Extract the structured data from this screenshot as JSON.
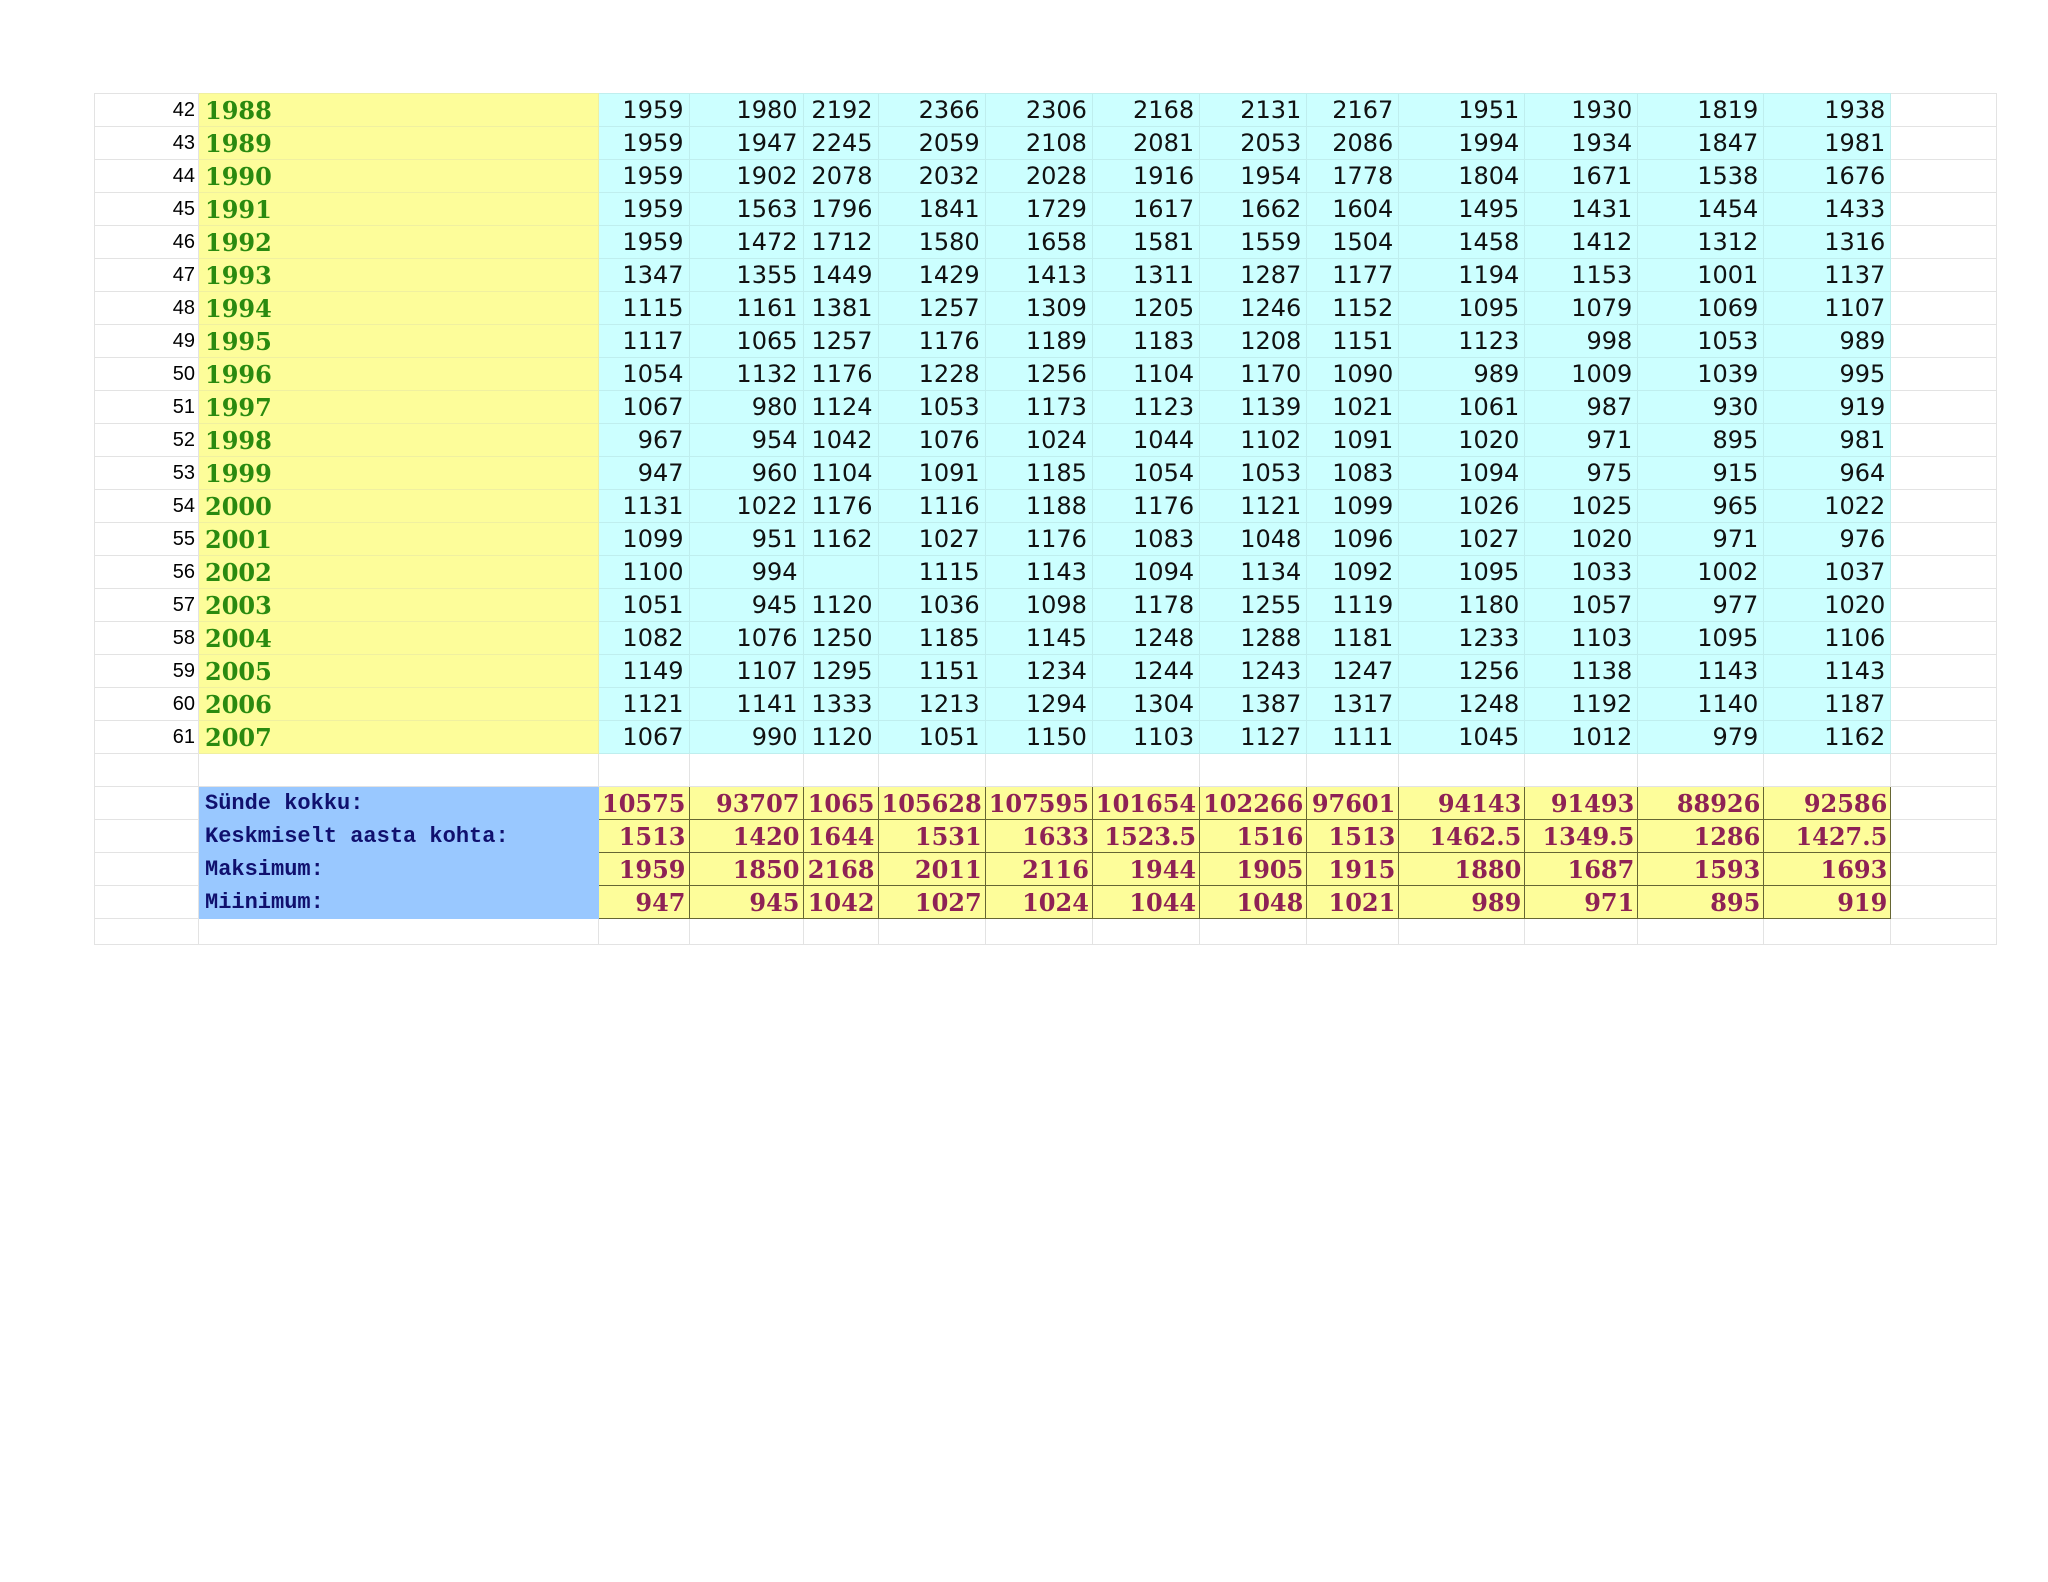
{
  "rows": [
    {
      "n": "42",
      "year": "1988",
      "v": [
        "1959",
        "1980",
        "2192",
        "2366",
        "2306",
        "2168",
        "2131",
        "2167",
        "1951",
        "1930",
        "1819",
        "1938"
      ]
    },
    {
      "n": "43",
      "year": "1989",
      "v": [
        "1959",
        "1947",
        "2245",
        "2059",
        "2108",
        "2081",
        "2053",
        "2086",
        "1994",
        "1934",
        "1847",
        "1981"
      ]
    },
    {
      "n": "44",
      "year": "1990",
      "v": [
        "1959",
        "1902",
        "2078",
        "2032",
        "2028",
        "1916",
        "1954",
        "1778",
        "1804",
        "1671",
        "1538",
        "1676"
      ]
    },
    {
      "n": "45",
      "year": "1991",
      "v": [
        "1959",
        "1563",
        "1796",
        "1841",
        "1729",
        "1617",
        "1662",
        "1604",
        "1495",
        "1431",
        "1454",
        "1433"
      ]
    },
    {
      "n": "46",
      "year": "1992",
      "v": [
        "1959",
        "1472",
        "1712",
        "1580",
        "1658",
        "1581",
        "1559",
        "1504",
        "1458",
        "1412",
        "1312",
        "1316"
      ]
    },
    {
      "n": "47",
      "year": "1993",
      "v": [
        "1347",
        "1355",
        "1449",
        "1429",
        "1413",
        "1311",
        "1287",
        "1177",
        "1194",
        "1153",
        "1001",
        "1137"
      ]
    },
    {
      "n": "48",
      "year": "1994",
      "v": [
        "1115",
        "1161",
        "1381",
        "1257",
        "1309",
        "1205",
        "1246",
        "1152",
        "1095",
        "1079",
        "1069",
        "1107"
      ]
    },
    {
      "n": "49",
      "year": "1995",
      "v": [
        "1117",
        "1065",
        "1257",
        "1176",
        "1189",
        "1183",
        "1208",
        "1151",
        "1123",
        "998",
        "1053",
        "989"
      ]
    },
    {
      "n": "50",
      "year": "1996",
      "v": [
        "1054",
        "1132",
        "1176",
        "1228",
        "1256",
        "1104",
        "1170",
        "1090",
        "989",
        "1009",
        "1039",
        "995"
      ]
    },
    {
      "n": "51",
      "year": "1997",
      "v": [
        "1067",
        "980",
        "1124",
        "1053",
        "1173",
        "1123",
        "1139",
        "1021",
        "1061",
        "987",
        "930",
        "919"
      ]
    },
    {
      "n": "52",
      "year": "1998",
      "v": [
        "967",
        "954",
        "1042",
        "1076",
        "1024",
        "1044",
        "1102",
        "1091",
        "1020",
        "971",
        "895",
        "981"
      ]
    },
    {
      "n": "53",
      "year": "1999",
      "v": [
        "947",
        "960",
        "1104",
        "1091",
        "1185",
        "1054",
        "1053",
        "1083",
        "1094",
        "975",
        "915",
        "964"
      ]
    },
    {
      "n": "54",
      "year": "2000",
      "v": [
        "1131",
        "1022",
        "1176",
        "1116",
        "1188",
        "1176",
        "1121",
        "1099",
        "1026",
        "1025",
        "965",
        "1022"
      ]
    },
    {
      "n": "55",
      "year": "2001",
      "v": [
        "1099",
        "951",
        "1162",
        "1027",
        "1176",
        "1083",
        "1048",
        "1096",
        "1027",
        "1020",
        "971",
        "976"
      ]
    },
    {
      "n": "56",
      "year": "2002",
      "v": [
        "1100",
        "994",
        "",
        "1115",
        "1143",
        "1094",
        "1134",
        "1092",
        "1095",
        "1033",
        "1002",
        "1037"
      ]
    },
    {
      "n": "57",
      "year": "2003",
      "v": [
        "1051",
        "945",
        "1120",
        "1036",
        "1098",
        "1178",
        "1255",
        "1119",
        "1180",
        "1057",
        "977",
        "1020"
      ]
    },
    {
      "n": "58",
      "year": "2004",
      "v": [
        "1082",
        "1076",
        "1250",
        "1185",
        "1145",
        "1248",
        "1288",
        "1181",
        "1233",
        "1103",
        "1095",
        "1106"
      ]
    },
    {
      "n": "59",
      "year": "2005",
      "v": [
        "1149",
        "1107",
        "1295",
        "1151",
        "1234",
        "1244",
        "1243",
        "1247",
        "1256",
        "1138",
        "1143",
        "1143"
      ]
    },
    {
      "n": "60",
      "year": "2006",
      "v": [
        "1121",
        "1141",
        "1333",
        "1213",
        "1294",
        "1304",
        "1387",
        "1317",
        "1248",
        "1192",
        "1140",
        "1187"
      ]
    },
    {
      "n": "61",
      "year": "2007",
      "v": [
        "1067",
        "990",
        "1120",
        "1051",
        "1150",
        "1103",
        "1127",
        "1111",
        "1045",
        "1012",
        "979",
        "1162"
      ]
    }
  ],
  "summary": [
    {
      "label": "Sünde kokku:",
      "v": [
        "10575",
        "93707",
        "1065",
        "105628",
        "107595",
        "101654",
        "102266",
        "97601",
        "94143",
        "91493",
        "88926",
        "92586"
      ]
    },
    {
      "label": "Keskmiselt aasta kohta:",
      "v": [
        "1513",
        "1420",
        "1644",
        "1531",
        "1633",
        "1523.5",
        "1516",
        "1513",
        "1462.5",
        "1349.5",
        "1286",
        "1427.5"
      ]
    },
    {
      "label": "Maksimum:",
      "v": [
        "1959",
        "1850",
        "2168",
        "2011",
        "2116",
        "1944",
        "1905",
        "1915",
        "1880",
        "1687",
        "1593",
        "1693"
      ]
    },
    {
      "label": "Miinimum:",
      "v": [
        "947",
        "945",
        "1042",
        "1027",
        "1024",
        "1044",
        "1048",
        "1021",
        "989",
        "971",
        "895",
        "919"
      ]
    }
  ]
}
